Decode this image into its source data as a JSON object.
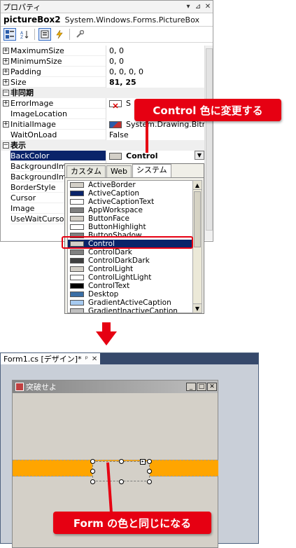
{
  "props_window": {
    "title": "プロパティ",
    "title_buttons": [
      "▾",
      "⊿",
      "✕"
    ],
    "object_name": "pictureBox2",
    "object_type": "System.Windows.Forms.PictureBox",
    "toolbar_icons": [
      "categorized-icon",
      "alphabetical-icon",
      "properties-icon",
      "events-icon",
      "property-pages-icon"
    ]
  },
  "property_rows": [
    {
      "exp": "+",
      "name": "MaximumSize",
      "value": "0, 0"
    },
    {
      "exp": "+",
      "name": "MinimumSize",
      "value": "0, 0"
    },
    {
      "exp": "+",
      "name": "Padding",
      "value": "0, 0, 0, 0"
    },
    {
      "exp": "+",
      "name": "Size",
      "value": "81, 25",
      "bold": true
    },
    {
      "exp": "−",
      "name": "非同期",
      "category": true
    },
    {
      "exp": "+",
      "name": "ErrorImage",
      "value": "S",
      "swatch": "error"
    },
    {
      "exp": "",
      "name": "ImageLocation",
      "value": ""
    },
    {
      "exp": "+",
      "name": "InitialImage",
      "value": "System.Drawing.Bitma",
      "swatch": "image"
    },
    {
      "exp": "",
      "name": "WaitOnLoad",
      "value": "False"
    },
    {
      "exp": "−",
      "name": "表示",
      "category": true
    },
    {
      "exp": "",
      "name": "BackColor",
      "value": "Control",
      "bold": true,
      "selected": true,
      "swatch": "control"
    },
    {
      "exp": "",
      "name": "BackgroundIma",
      "value": ""
    },
    {
      "exp": "",
      "name": "BackgroundIma",
      "value": ""
    },
    {
      "exp": "",
      "name": "BorderStyle",
      "value": ""
    },
    {
      "exp": "",
      "name": "Cursor",
      "value": ""
    },
    {
      "exp": "",
      "name": "Image",
      "value": ""
    },
    {
      "exp": "",
      "name": "UseWaitCursor",
      "value": ""
    }
  ],
  "dropdown": {
    "tabs": [
      "カスタム",
      "Web",
      "システム"
    ],
    "active_tab": "システム",
    "colors": [
      {
        "name": "ActiveBorder",
        "color": "#d4d0c8"
      },
      {
        "name": "ActiveCaption",
        "color": "#0a246a"
      },
      {
        "name": "ActiveCaptionText",
        "color": "#ffffff"
      },
      {
        "name": "AppWorkspace",
        "color": "#808080"
      },
      {
        "name": "ButtonFace",
        "color": "#d4d0c8"
      },
      {
        "name": "ButtonHighlight",
        "color": "#ffffff"
      },
      {
        "name": "ButtonShadow",
        "color": "#808080"
      },
      {
        "name": "Control",
        "color": "#d4d0c8",
        "selected": true
      },
      {
        "name": "ControlDark",
        "color": "#808080"
      },
      {
        "name": "ControlDarkDark",
        "color": "#404040"
      },
      {
        "name": "ControlLight",
        "color": "#d4d0c8"
      },
      {
        "name": "ControlLightLight",
        "color": "#ffffff"
      },
      {
        "name": "ControlText",
        "color": "#000000"
      },
      {
        "name": "Desktop",
        "color": "#3a6ea5"
      },
      {
        "name": "GradientActiveCaption",
        "color": "#a6caf0"
      },
      {
        "name": "GradientInactiveCaption",
        "color": "#c0c0c0"
      }
    ]
  },
  "callout_top": "Control  色に変更する",
  "callout_bottom": "Form  の色と同じになる",
  "designer": {
    "tab_label": "Form1.cs [デザイン]*",
    "tab_pin": "ᵖ",
    "tab_close": "✕",
    "form_title": "突破せよ",
    "window_buttons": [
      "_",
      "□",
      "✕"
    ]
  },
  "colors": {
    "accent_red": "#e60012",
    "orange_band": "#ffa500",
    "selection": "#0a246a"
  }
}
